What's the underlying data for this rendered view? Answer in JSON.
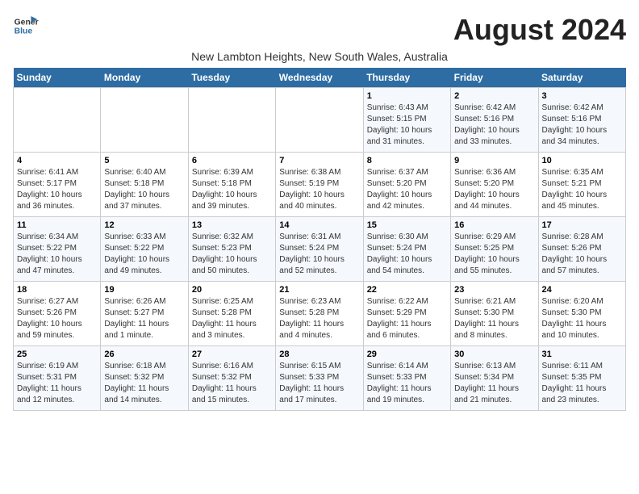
{
  "header": {
    "logo_line1": "General",
    "logo_line2": "Blue",
    "month": "August 2024",
    "location": "New Lambton Heights, New South Wales, Australia"
  },
  "days_of_week": [
    "Sunday",
    "Monday",
    "Tuesday",
    "Wednesday",
    "Thursday",
    "Friday",
    "Saturday"
  ],
  "weeks": [
    [
      {
        "day": "",
        "info": ""
      },
      {
        "day": "",
        "info": ""
      },
      {
        "day": "",
        "info": ""
      },
      {
        "day": "",
        "info": ""
      },
      {
        "day": "1",
        "info": "Sunrise: 6:43 AM\nSunset: 5:15 PM\nDaylight: 10 hours\nand 31 minutes."
      },
      {
        "day": "2",
        "info": "Sunrise: 6:42 AM\nSunset: 5:16 PM\nDaylight: 10 hours\nand 33 minutes."
      },
      {
        "day": "3",
        "info": "Sunrise: 6:42 AM\nSunset: 5:16 PM\nDaylight: 10 hours\nand 34 minutes."
      }
    ],
    [
      {
        "day": "4",
        "info": "Sunrise: 6:41 AM\nSunset: 5:17 PM\nDaylight: 10 hours\nand 36 minutes."
      },
      {
        "day": "5",
        "info": "Sunrise: 6:40 AM\nSunset: 5:18 PM\nDaylight: 10 hours\nand 37 minutes."
      },
      {
        "day": "6",
        "info": "Sunrise: 6:39 AM\nSunset: 5:18 PM\nDaylight: 10 hours\nand 39 minutes."
      },
      {
        "day": "7",
        "info": "Sunrise: 6:38 AM\nSunset: 5:19 PM\nDaylight: 10 hours\nand 40 minutes."
      },
      {
        "day": "8",
        "info": "Sunrise: 6:37 AM\nSunset: 5:20 PM\nDaylight: 10 hours\nand 42 minutes."
      },
      {
        "day": "9",
        "info": "Sunrise: 6:36 AM\nSunset: 5:20 PM\nDaylight: 10 hours\nand 44 minutes."
      },
      {
        "day": "10",
        "info": "Sunrise: 6:35 AM\nSunset: 5:21 PM\nDaylight: 10 hours\nand 45 minutes."
      }
    ],
    [
      {
        "day": "11",
        "info": "Sunrise: 6:34 AM\nSunset: 5:22 PM\nDaylight: 10 hours\nand 47 minutes."
      },
      {
        "day": "12",
        "info": "Sunrise: 6:33 AM\nSunset: 5:22 PM\nDaylight: 10 hours\nand 49 minutes."
      },
      {
        "day": "13",
        "info": "Sunrise: 6:32 AM\nSunset: 5:23 PM\nDaylight: 10 hours\nand 50 minutes."
      },
      {
        "day": "14",
        "info": "Sunrise: 6:31 AM\nSunset: 5:24 PM\nDaylight: 10 hours\nand 52 minutes."
      },
      {
        "day": "15",
        "info": "Sunrise: 6:30 AM\nSunset: 5:24 PM\nDaylight: 10 hours\nand 54 minutes."
      },
      {
        "day": "16",
        "info": "Sunrise: 6:29 AM\nSunset: 5:25 PM\nDaylight: 10 hours\nand 55 minutes."
      },
      {
        "day": "17",
        "info": "Sunrise: 6:28 AM\nSunset: 5:26 PM\nDaylight: 10 hours\nand 57 minutes."
      }
    ],
    [
      {
        "day": "18",
        "info": "Sunrise: 6:27 AM\nSunset: 5:26 PM\nDaylight: 10 hours\nand 59 minutes."
      },
      {
        "day": "19",
        "info": "Sunrise: 6:26 AM\nSunset: 5:27 PM\nDaylight: 11 hours\nand 1 minute."
      },
      {
        "day": "20",
        "info": "Sunrise: 6:25 AM\nSunset: 5:28 PM\nDaylight: 11 hours\nand 3 minutes."
      },
      {
        "day": "21",
        "info": "Sunrise: 6:23 AM\nSunset: 5:28 PM\nDaylight: 11 hours\nand 4 minutes."
      },
      {
        "day": "22",
        "info": "Sunrise: 6:22 AM\nSunset: 5:29 PM\nDaylight: 11 hours\nand 6 minutes."
      },
      {
        "day": "23",
        "info": "Sunrise: 6:21 AM\nSunset: 5:30 PM\nDaylight: 11 hours\nand 8 minutes."
      },
      {
        "day": "24",
        "info": "Sunrise: 6:20 AM\nSunset: 5:30 PM\nDaylight: 11 hours\nand 10 minutes."
      }
    ],
    [
      {
        "day": "25",
        "info": "Sunrise: 6:19 AM\nSunset: 5:31 PM\nDaylight: 11 hours\nand 12 minutes."
      },
      {
        "day": "26",
        "info": "Sunrise: 6:18 AM\nSunset: 5:32 PM\nDaylight: 11 hours\nand 14 minutes."
      },
      {
        "day": "27",
        "info": "Sunrise: 6:16 AM\nSunset: 5:32 PM\nDaylight: 11 hours\nand 15 minutes."
      },
      {
        "day": "28",
        "info": "Sunrise: 6:15 AM\nSunset: 5:33 PM\nDaylight: 11 hours\nand 17 minutes."
      },
      {
        "day": "29",
        "info": "Sunrise: 6:14 AM\nSunset: 5:33 PM\nDaylight: 11 hours\nand 19 minutes."
      },
      {
        "day": "30",
        "info": "Sunrise: 6:13 AM\nSunset: 5:34 PM\nDaylight: 11 hours\nand 21 minutes."
      },
      {
        "day": "31",
        "info": "Sunrise: 6:11 AM\nSunset: 5:35 PM\nDaylight: 11 hours\nand 23 minutes."
      }
    ]
  ]
}
